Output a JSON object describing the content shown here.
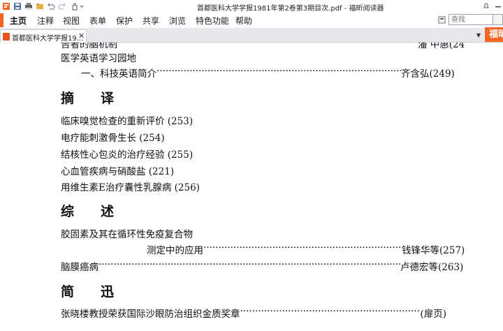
{
  "window": {
    "title": "首都医科大学学报1981年第2卷第3期目次.pdf - 福昕阅读器"
  },
  "menu": {
    "items": [
      "主页",
      "注释",
      "视图",
      "表单",
      "保护",
      "共享",
      "浏览",
      "特色功能",
      "帮助"
    ]
  },
  "search": {
    "placeholder": "查找"
  },
  "tab": {
    "label": "首都医科大学学报19..."
  },
  "brand": {
    "label": "福昕",
    "color": "#f26522"
  },
  "document": {
    "partial_top": "告者的脑机制",
    "partial_top_right": "潘 中惠(24",
    "section_title": "医学英语学习园地",
    "entry_1": {
      "title": "一、科技英语简介",
      "author": "齐含弘",
      "page": "(249)"
    },
    "heading_abstracts": "摘　　译",
    "abstracts": [
      "临床嗅觉检查的重新评价 (253)",
      "电疗能刺激骨生长 (254)",
      "结核性心包炎的治疗经验 (255)",
      "心血管疾病与硝酸盐 (221)",
      "用维生素E治疗囊性乳腺病 (256)"
    ],
    "heading_reviews": "综　　述",
    "review_1_line1": "胶固素及其在循环性免疫复合物",
    "review_1_line2": "测定中的应用",
    "review_1_author": "钱锋华等",
    "review_1_page": "(257)",
    "review_2_title": "脑膜癌病",
    "review_2_author": "卢德宏等",
    "review_2_page": "(263)",
    "heading_news": "简　　迅",
    "news_1_title": "张晓楼教授荣获国际沙眼防治组织金质奖章",
    "news_1_page": "(扉页)"
  }
}
